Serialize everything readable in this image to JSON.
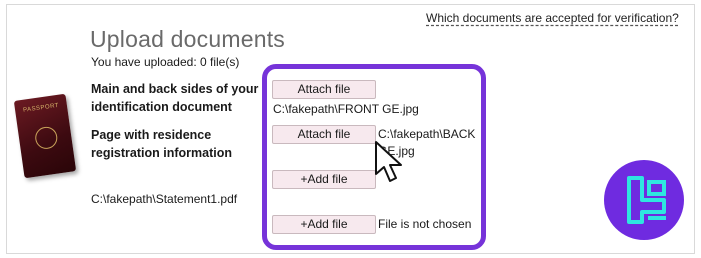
{
  "help_link": "Which documents are accepted for verification?",
  "title": "Upload documents",
  "uploaded_status": "You have uploaded: 0 file(s)",
  "sections": {
    "main": {
      "label": "Main and back sides of your identification document",
      "button": "Attach file",
      "file": "C:\\fakepath\\FRONT GE.jpg"
    },
    "residence": {
      "label": "Page with residence registration information",
      "button": "Attach file",
      "file": "C:\\fakepath\\BACK GE.jpg"
    },
    "additional": [
      {
        "button": "+Add file",
        "file": "C:\\fakepath\\Statement1.pdf"
      },
      {
        "button": "+Add file",
        "file": "File is not chosen"
      }
    ]
  },
  "passport_text": "PASSPORT",
  "colors": {
    "highlight": "#7633d9",
    "button_bg": "#f7e9ee",
    "logo_bg": "#6f2be0",
    "logo_mark": "#2ee6e0"
  },
  "icons": [
    "passport-icon",
    "mouse-cursor-icon",
    "brand-logo-icon"
  ]
}
